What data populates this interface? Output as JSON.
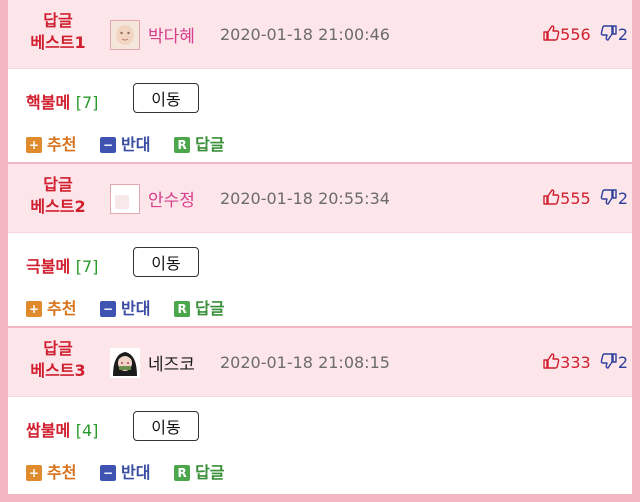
{
  "comments": [
    {
      "rank_line1": "답글",
      "rank_line2": "베스트1",
      "author": "박다혜",
      "author_color": "#d63f8c",
      "date": "2020-01-18 21:00:46",
      "up": "556",
      "down": "2",
      "title": "핵불메",
      "count": "[7]",
      "move_label": "이동",
      "actions": {
        "recommend": "추천",
        "oppose": "반대",
        "reply": "답글"
      }
    },
    {
      "rank_line1": "답글",
      "rank_line2": "베스트2",
      "author": "안수정",
      "author_color": "#d63f8c",
      "date": "2020-01-18 20:55:34",
      "up": "555",
      "down": "2",
      "title": "극불메",
      "count": "[7]",
      "move_label": "이동",
      "actions": {
        "recommend": "추천",
        "oppose": "반대",
        "reply": "답글"
      }
    },
    {
      "rank_line1": "답글",
      "rank_line2": "베스트3",
      "author": "네즈코",
      "author_color": "#1a1a1a",
      "date": "2020-01-18 21:08:15",
      "up": "333",
      "down": "2",
      "title": "쌉불메",
      "count": "[4]",
      "move_label": "이동",
      "actions": {
        "recommend": "추천",
        "oppose": "반대",
        "reply": "답글"
      }
    }
  ],
  "icons": {
    "thumb_up": "thumbs-up-icon",
    "thumb_down": "thumbs-down-icon",
    "plus": "plus-icon",
    "minus": "minus-icon",
    "reply": "reply-r-icon"
  },
  "colors": {
    "accent_red": "#d01f2f",
    "header_bg": "#fde6ea",
    "frame": "#f4b6c2"
  }
}
